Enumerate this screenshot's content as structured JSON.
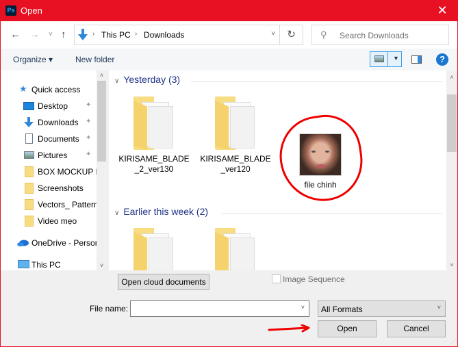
{
  "window": {
    "title": "Open",
    "app_icon_text": "Ps",
    "close_glyph": "✕"
  },
  "nav": {
    "back": "←",
    "forward": "→",
    "recent": "˅",
    "up": "↑",
    "breadcrumb": [
      "This PC",
      "Downloads"
    ],
    "breadcrumb_sep": "›",
    "dropdown": "˅",
    "refresh": "↻",
    "search_placeholder": "Search Downloads",
    "search_glyph": "⚲"
  },
  "toolbar": {
    "organize": "Organize ▾",
    "new_folder": "New folder",
    "help": "?",
    "view_caret": "▼"
  },
  "sidebar": {
    "items": [
      {
        "label": "Quick access",
        "icon": "star-icon"
      },
      {
        "label": "Desktop",
        "icon": "desktop-icon",
        "pinned": true
      },
      {
        "label": "Downloads",
        "icon": "download-icon",
        "pinned": true
      },
      {
        "label": "Documents",
        "icon": "document-icon",
        "pinned": true
      },
      {
        "label": "Pictures",
        "icon": "pictures-icon",
        "pinned": true
      },
      {
        "label": "BOX MOCKUP IN",
        "icon": "folder-icon"
      },
      {
        "label": "Screenshots",
        "icon": "folder-icon"
      },
      {
        "label": "Vectors_ Pattern",
        "icon": "folder-icon"
      },
      {
        "label": "Video mẹo",
        "icon": "folder-icon"
      },
      {
        "label": "OneDrive - Person",
        "icon": "onedrive-icon"
      },
      {
        "label": "This PC",
        "icon": "pc-icon"
      }
    ],
    "pin_glyph": "📌",
    "scroll_up": "˄",
    "scroll_down": "˅"
  },
  "content": {
    "groups": [
      {
        "header": "Yesterday (3)",
        "files": [
          {
            "name": "KIRISAME_BLADE_2_ver130",
            "type": "folder"
          },
          {
            "name": "KIRISAME_BLADE_ver120",
            "type": "folder"
          },
          {
            "name": "file chinh",
            "type": "image"
          }
        ]
      },
      {
        "header": "Earlier this week (2)",
        "files": [
          {
            "name": "",
            "type": "folder"
          },
          {
            "name": "",
            "type": "folder"
          }
        ]
      }
    ],
    "group_chevron": "∨"
  },
  "bottom": {
    "open_cloud": "Open cloud documents",
    "image_sequence": "Image Sequence",
    "file_name_label": "File name:",
    "file_name_value": "",
    "format_value": "All Formats",
    "dropdown": "˅",
    "open": "Open",
    "cancel": "Cancel",
    "grip": "⋰"
  },
  "colors": {
    "titlebar": "#e81123",
    "annotation": "#e00000",
    "group_header": "#1e3287"
  }
}
